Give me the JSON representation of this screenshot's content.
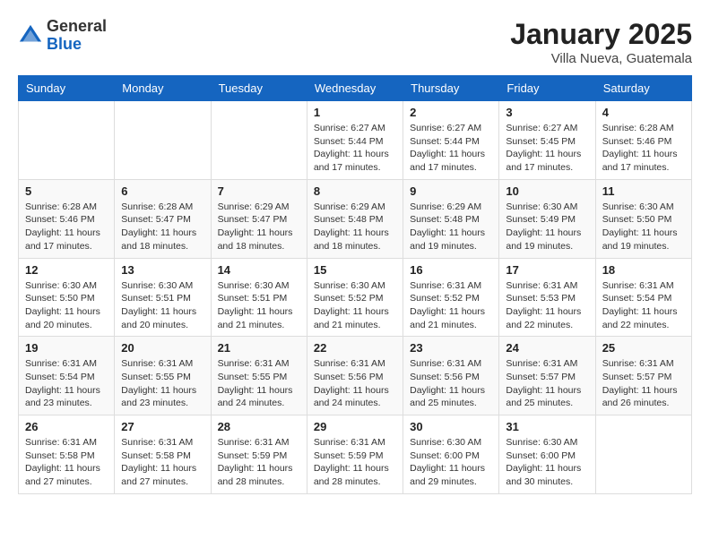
{
  "header": {
    "logo_general": "General",
    "logo_blue": "Blue",
    "month_year": "January 2025",
    "location": "Villa Nueva, Guatemala"
  },
  "days_of_week": [
    "Sunday",
    "Monday",
    "Tuesday",
    "Wednesday",
    "Thursday",
    "Friday",
    "Saturday"
  ],
  "weeks": [
    [
      {
        "day": "",
        "sunrise": "",
        "sunset": "",
        "daylight": ""
      },
      {
        "day": "",
        "sunrise": "",
        "sunset": "",
        "daylight": ""
      },
      {
        "day": "",
        "sunrise": "",
        "sunset": "",
        "daylight": ""
      },
      {
        "day": "1",
        "sunrise": "Sunrise: 6:27 AM",
        "sunset": "Sunset: 5:44 PM",
        "daylight": "Daylight: 11 hours and 17 minutes."
      },
      {
        "day": "2",
        "sunrise": "Sunrise: 6:27 AM",
        "sunset": "Sunset: 5:44 PM",
        "daylight": "Daylight: 11 hours and 17 minutes."
      },
      {
        "day": "3",
        "sunrise": "Sunrise: 6:27 AM",
        "sunset": "Sunset: 5:45 PM",
        "daylight": "Daylight: 11 hours and 17 minutes."
      },
      {
        "day": "4",
        "sunrise": "Sunrise: 6:28 AM",
        "sunset": "Sunset: 5:46 PM",
        "daylight": "Daylight: 11 hours and 17 minutes."
      }
    ],
    [
      {
        "day": "5",
        "sunrise": "Sunrise: 6:28 AM",
        "sunset": "Sunset: 5:46 PM",
        "daylight": "Daylight: 11 hours and 17 minutes."
      },
      {
        "day": "6",
        "sunrise": "Sunrise: 6:28 AM",
        "sunset": "Sunset: 5:47 PM",
        "daylight": "Daylight: 11 hours and 18 minutes."
      },
      {
        "day": "7",
        "sunrise": "Sunrise: 6:29 AM",
        "sunset": "Sunset: 5:47 PM",
        "daylight": "Daylight: 11 hours and 18 minutes."
      },
      {
        "day": "8",
        "sunrise": "Sunrise: 6:29 AM",
        "sunset": "Sunset: 5:48 PM",
        "daylight": "Daylight: 11 hours and 18 minutes."
      },
      {
        "day": "9",
        "sunrise": "Sunrise: 6:29 AM",
        "sunset": "Sunset: 5:48 PM",
        "daylight": "Daylight: 11 hours and 19 minutes."
      },
      {
        "day": "10",
        "sunrise": "Sunrise: 6:30 AM",
        "sunset": "Sunset: 5:49 PM",
        "daylight": "Daylight: 11 hours and 19 minutes."
      },
      {
        "day": "11",
        "sunrise": "Sunrise: 6:30 AM",
        "sunset": "Sunset: 5:50 PM",
        "daylight": "Daylight: 11 hours and 19 minutes."
      }
    ],
    [
      {
        "day": "12",
        "sunrise": "Sunrise: 6:30 AM",
        "sunset": "Sunset: 5:50 PM",
        "daylight": "Daylight: 11 hours and 20 minutes."
      },
      {
        "day": "13",
        "sunrise": "Sunrise: 6:30 AM",
        "sunset": "Sunset: 5:51 PM",
        "daylight": "Daylight: 11 hours and 20 minutes."
      },
      {
        "day": "14",
        "sunrise": "Sunrise: 6:30 AM",
        "sunset": "Sunset: 5:51 PM",
        "daylight": "Daylight: 11 hours and 21 minutes."
      },
      {
        "day": "15",
        "sunrise": "Sunrise: 6:30 AM",
        "sunset": "Sunset: 5:52 PM",
        "daylight": "Daylight: 11 hours and 21 minutes."
      },
      {
        "day": "16",
        "sunrise": "Sunrise: 6:31 AM",
        "sunset": "Sunset: 5:52 PM",
        "daylight": "Daylight: 11 hours and 21 minutes."
      },
      {
        "day": "17",
        "sunrise": "Sunrise: 6:31 AM",
        "sunset": "Sunset: 5:53 PM",
        "daylight": "Daylight: 11 hours and 22 minutes."
      },
      {
        "day": "18",
        "sunrise": "Sunrise: 6:31 AM",
        "sunset": "Sunset: 5:54 PM",
        "daylight": "Daylight: 11 hours and 22 minutes."
      }
    ],
    [
      {
        "day": "19",
        "sunrise": "Sunrise: 6:31 AM",
        "sunset": "Sunset: 5:54 PM",
        "daylight": "Daylight: 11 hours and 23 minutes."
      },
      {
        "day": "20",
        "sunrise": "Sunrise: 6:31 AM",
        "sunset": "Sunset: 5:55 PM",
        "daylight": "Daylight: 11 hours and 23 minutes."
      },
      {
        "day": "21",
        "sunrise": "Sunrise: 6:31 AM",
        "sunset": "Sunset: 5:55 PM",
        "daylight": "Daylight: 11 hours and 24 minutes."
      },
      {
        "day": "22",
        "sunrise": "Sunrise: 6:31 AM",
        "sunset": "Sunset: 5:56 PM",
        "daylight": "Daylight: 11 hours and 24 minutes."
      },
      {
        "day": "23",
        "sunrise": "Sunrise: 6:31 AM",
        "sunset": "Sunset: 5:56 PM",
        "daylight": "Daylight: 11 hours and 25 minutes."
      },
      {
        "day": "24",
        "sunrise": "Sunrise: 6:31 AM",
        "sunset": "Sunset: 5:57 PM",
        "daylight": "Daylight: 11 hours and 25 minutes."
      },
      {
        "day": "25",
        "sunrise": "Sunrise: 6:31 AM",
        "sunset": "Sunset: 5:57 PM",
        "daylight": "Daylight: 11 hours and 26 minutes."
      }
    ],
    [
      {
        "day": "26",
        "sunrise": "Sunrise: 6:31 AM",
        "sunset": "Sunset: 5:58 PM",
        "daylight": "Daylight: 11 hours and 27 minutes."
      },
      {
        "day": "27",
        "sunrise": "Sunrise: 6:31 AM",
        "sunset": "Sunset: 5:58 PM",
        "daylight": "Daylight: 11 hours and 27 minutes."
      },
      {
        "day": "28",
        "sunrise": "Sunrise: 6:31 AM",
        "sunset": "Sunset: 5:59 PM",
        "daylight": "Daylight: 11 hours and 28 minutes."
      },
      {
        "day": "29",
        "sunrise": "Sunrise: 6:31 AM",
        "sunset": "Sunset: 5:59 PM",
        "daylight": "Daylight: 11 hours and 28 minutes."
      },
      {
        "day": "30",
        "sunrise": "Sunrise: 6:30 AM",
        "sunset": "Sunset: 6:00 PM",
        "daylight": "Daylight: 11 hours and 29 minutes."
      },
      {
        "day": "31",
        "sunrise": "Sunrise: 6:30 AM",
        "sunset": "Sunset: 6:00 PM",
        "daylight": "Daylight: 11 hours and 30 minutes."
      },
      {
        "day": "",
        "sunrise": "",
        "sunset": "",
        "daylight": ""
      }
    ]
  ]
}
